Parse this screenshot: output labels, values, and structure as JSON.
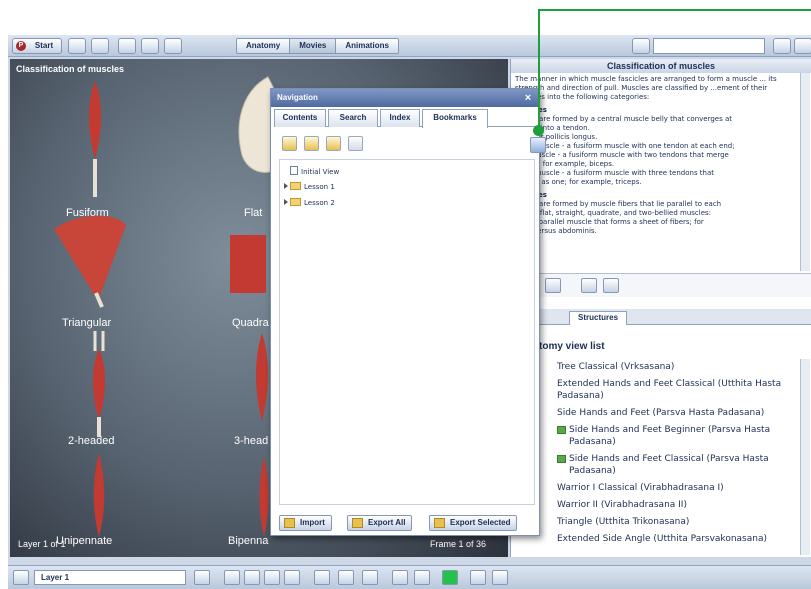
{
  "toolbar": {
    "start_label": "Start",
    "tabs": [
      {
        "label": "Anatomy"
      },
      {
        "label": "Movies"
      },
      {
        "label": "Animations"
      }
    ]
  },
  "viewport": {
    "title": "Classification of muscles",
    "muscles": [
      {
        "label": "Fusiform"
      },
      {
        "label": "Flat"
      },
      {
        "label": "Triangular"
      },
      {
        "label": "Quadra"
      },
      {
        "label": "2-headed"
      },
      {
        "label": "3-head"
      },
      {
        "label": "Unipennate"
      },
      {
        "label": "Bipenna"
      }
    ],
    "layer_text": "Layer 1 of 1",
    "frame_text": "Frame 1 of 36"
  },
  "right_panel": {
    "title": "Classification of muscles",
    "intro": "The manner in which muscle fascicles are arranged to form a muscle ... its strength and direction of pull. Muscles are classified by ...ement of their fascicles into the following categories:",
    "section1_title": "muscles",
    "section1_lines": [
      "uscles are formed by a central muscle belly that converges at",
      "h ends into a tendon.",
      "e, flexor pollicis longus.",
      "aded muscle - a fusiform muscle with one tendon at each end;",
      "ded muscle - a fusiform muscle with two tendons that merge",
      "as one; for example, biceps.",
      "aded muscle - a fusiform muscle with three tendons that",
      "l insert as one; for example, triceps."
    ],
    "section2_title": "muscles",
    "section2_lines": [
      "uscles are formed by muscle fibers that lie parallel to each",
      "y form flat, straight, quadrate, and two-bellied muscles:",
      "cle - a parallel muscle that forms a sheet of fibers; for",
      "transversus abdominis."
    ],
    "lower_tab": "Structures",
    "list_title": "tomy view list",
    "list_items": [
      {
        "text": "Tree Classical (Vrksasana)",
        "icon": false
      },
      {
        "text": "Extended Hands and Feet Classical (Utthita Hasta Padasana)",
        "icon": false
      },
      {
        "text": "Side Hands and Feet (Parsva Hasta Padasana)",
        "icon": false
      },
      {
        "text": "Side Hands and Feet Beginner (Parsva Hasta Padasana)",
        "icon": true
      },
      {
        "text": "Side Hands and Feet Classical (Parsva Hasta Padasana)",
        "icon": true
      },
      {
        "text": "Warrior I Classical (Virabhadrasana I)",
        "icon": false
      },
      {
        "text": "Warrior II (Virabhadrasana II)",
        "icon": false
      },
      {
        "text": "Triangle (Utthita Trikonasana)",
        "icon": false
      },
      {
        "text": "Extended Side Angle (Utthita Parsvakonasana)",
        "icon": false
      }
    ]
  },
  "bottom_bar": {
    "layer_value": "Layer 1"
  },
  "navigation": {
    "title": "Navigation",
    "close": "×",
    "tabs": [
      "Contents",
      "Search",
      "Index",
      "Bookmarks"
    ],
    "active_tab": "Bookmarks",
    "tree": [
      {
        "label": "Initial View"
      },
      {
        "label": "Lesson 1"
      },
      {
        "label": "Lesson 2"
      }
    ],
    "import_label": "Import",
    "export_all_label": "Export All",
    "export_selected_label": "Export Selected"
  },
  "colors": {
    "callout": "#1e9f3a",
    "accent": "#1d2f55"
  }
}
